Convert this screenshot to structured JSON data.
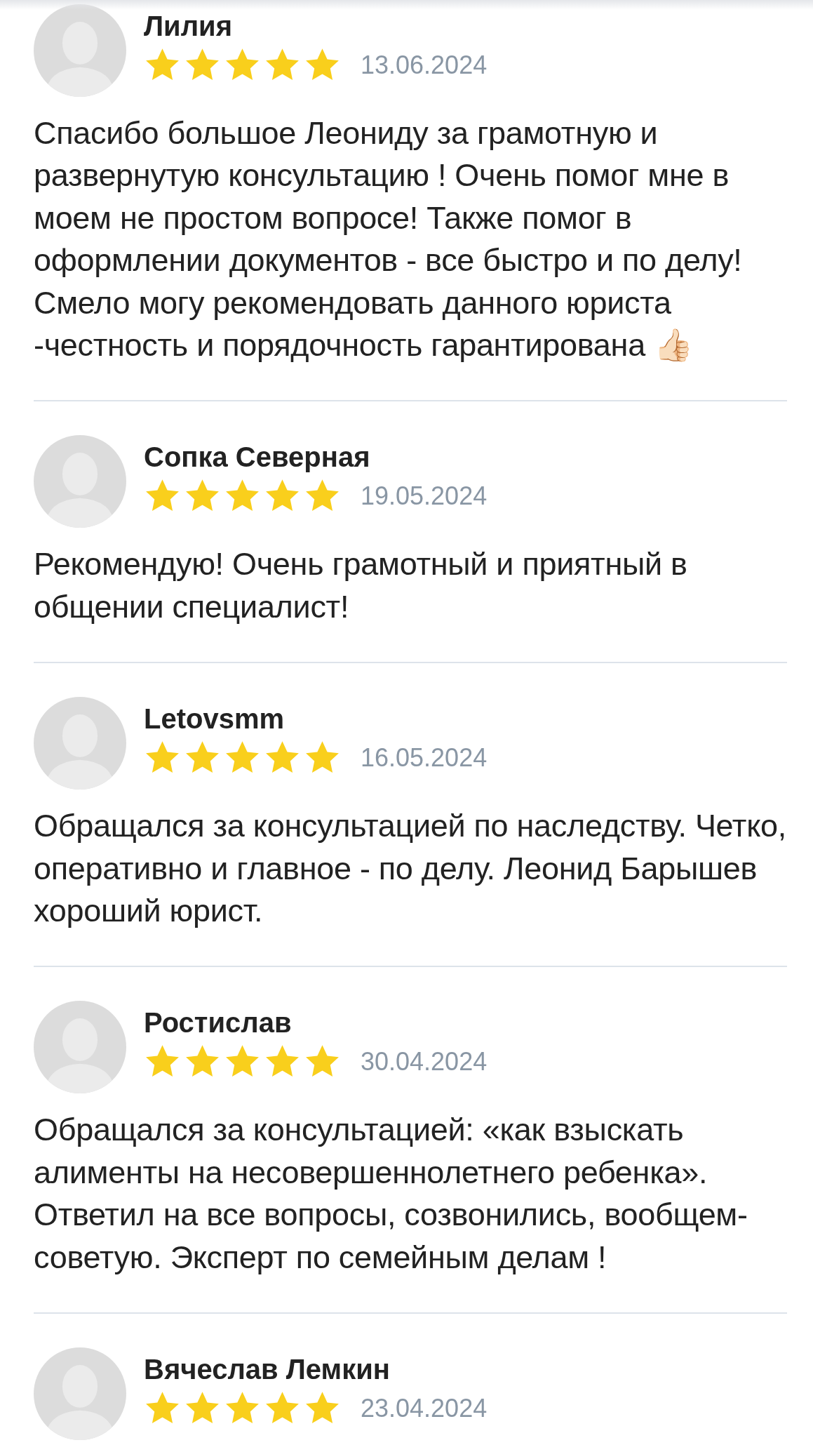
{
  "reviews": [
    {
      "name": "Лилия",
      "stars": 5,
      "date": "13.06.2024",
      "text": "Спасибо большое Леониду за грамотную и развернутую консультацию ! Очень помог мне в моем не простом вопросе! Также помог в оформлении документов - все быстро и по делу! Смело могу рекомендовать данного юриста -честность и порядочность гарантирована 👍🏻"
    },
    {
      "name": "Сопка Северная",
      "stars": 5,
      "date": "19.05.2024",
      "text": "Рекомендую! Очень грамотный и приятный в общении специалист!"
    },
    {
      "name": "Letovsmm",
      "stars": 5,
      "date": "16.05.2024",
      "text": "Обращался за консультацией по наследству. Четко, оперативно и главное - по делу. Леонид Барышев хороший юрист."
    },
    {
      "name": "Ростислав",
      "stars": 5,
      "date": "30.04.2024",
      "text": "Обращался за консультацией: «как взыскать алименты на несовершеннолетнего ребенка». Ответил на все вопросы, созвонились, вообщем- советую. Эксперт по семейным делам !"
    },
    {
      "name": "Вячеслав Лемкин",
      "stars": 5,
      "date": "23.04.2024"
    }
  ]
}
